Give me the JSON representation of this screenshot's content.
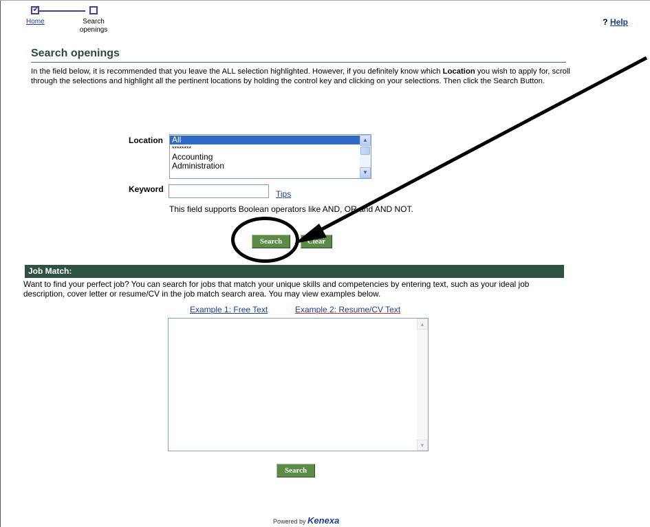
{
  "progress": {
    "home_label": "Home",
    "search_label": "Search openings"
  },
  "help": {
    "mark": "?",
    "label": "Help"
  },
  "page_title": "Search openings",
  "intro": {
    "before_bold": "In the field below, it is recommended that you leave the ALL selection highlighted. However, if you definitely know which ",
    "bold": "Location",
    "after_bold": " you wish to apply for, scroll through the selections and highlight all the pertinent locations by holding the control key and clicking on your selections. Then click the Search Button."
  },
  "location": {
    "label": "Location",
    "options": [
      "All",
      "********",
      "Accounting",
      "Administration"
    ],
    "selected": "All"
  },
  "keyword": {
    "label": "Keyword",
    "value": "",
    "tips_label": "Tips",
    "note": "This field supports Boolean operators like AND, OR and AND NOT."
  },
  "buttons": {
    "search": "Search",
    "clear": "Clear",
    "job_match_search": "Search"
  },
  "job_match": {
    "heading": "Job Match:",
    "description": "Want to find your perfect job? You can search for jobs that match your unique skills and competencies by entering text, such as your ideal job description, cover letter or resume/CV in the job match search area. You may view examples below.",
    "example1": "Example 1: Free Text",
    "example2": "Example 2: Resume/CV Text",
    "textarea_value": ""
  },
  "footer": {
    "powered_by": "Powered by",
    "brand": "Kenexa"
  },
  "colors": {
    "button_green": "#5c8a47",
    "section_bar": "#2f5141",
    "link": "#1a3d8f",
    "selection": "#316ac5"
  }
}
